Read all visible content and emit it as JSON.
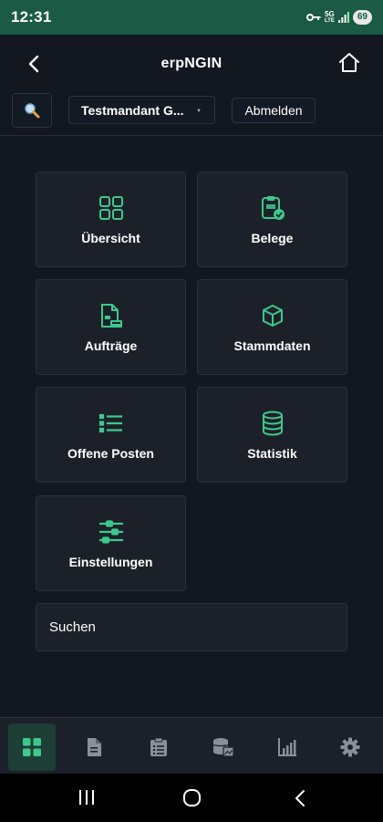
{
  "status_bar": {
    "time": "12:31",
    "network_top": "5G",
    "network_bottom": "LTE",
    "battery": "69"
  },
  "app_bar": {
    "title": "erpNGIN"
  },
  "toolbar": {
    "tenant": "Testmandant G...",
    "logout_label": "Abmelden"
  },
  "tiles": [
    {
      "label": "Übersicht",
      "icon": "grid-icon"
    },
    {
      "label": "Belege",
      "icon": "clipboard-check-icon"
    },
    {
      "label": "Aufträge",
      "icon": "document-order-icon"
    },
    {
      "label": "Stammdaten",
      "icon": "cube-icon"
    },
    {
      "label": "Offene Posten",
      "icon": "list-icon"
    },
    {
      "label": "Statistik",
      "icon": "database-icon"
    },
    {
      "label": "Einstellungen",
      "icon": "sliders-icon"
    }
  ],
  "search": {
    "label": "Suchen"
  },
  "bottom_nav": [
    {
      "icon": "grid-icon",
      "active": true
    },
    {
      "icon": "document-icon",
      "active": false
    },
    {
      "icon": "clipboard-list-icon",
      "active": false
    },
    {
      "icon": "database-image-icon",
      "active": false
    },
    {
      "icon": "bar-chart-icon",
      "active": false
    },
    {
      "icon": "gear-icon",
      "active": false
    }
  ],
  "colors": {
    "accent": "#3ec88e",
    "status_bar": "#1b5a45",
    "background": "#121720",
    "tile": "#1c2129"
  }
}
